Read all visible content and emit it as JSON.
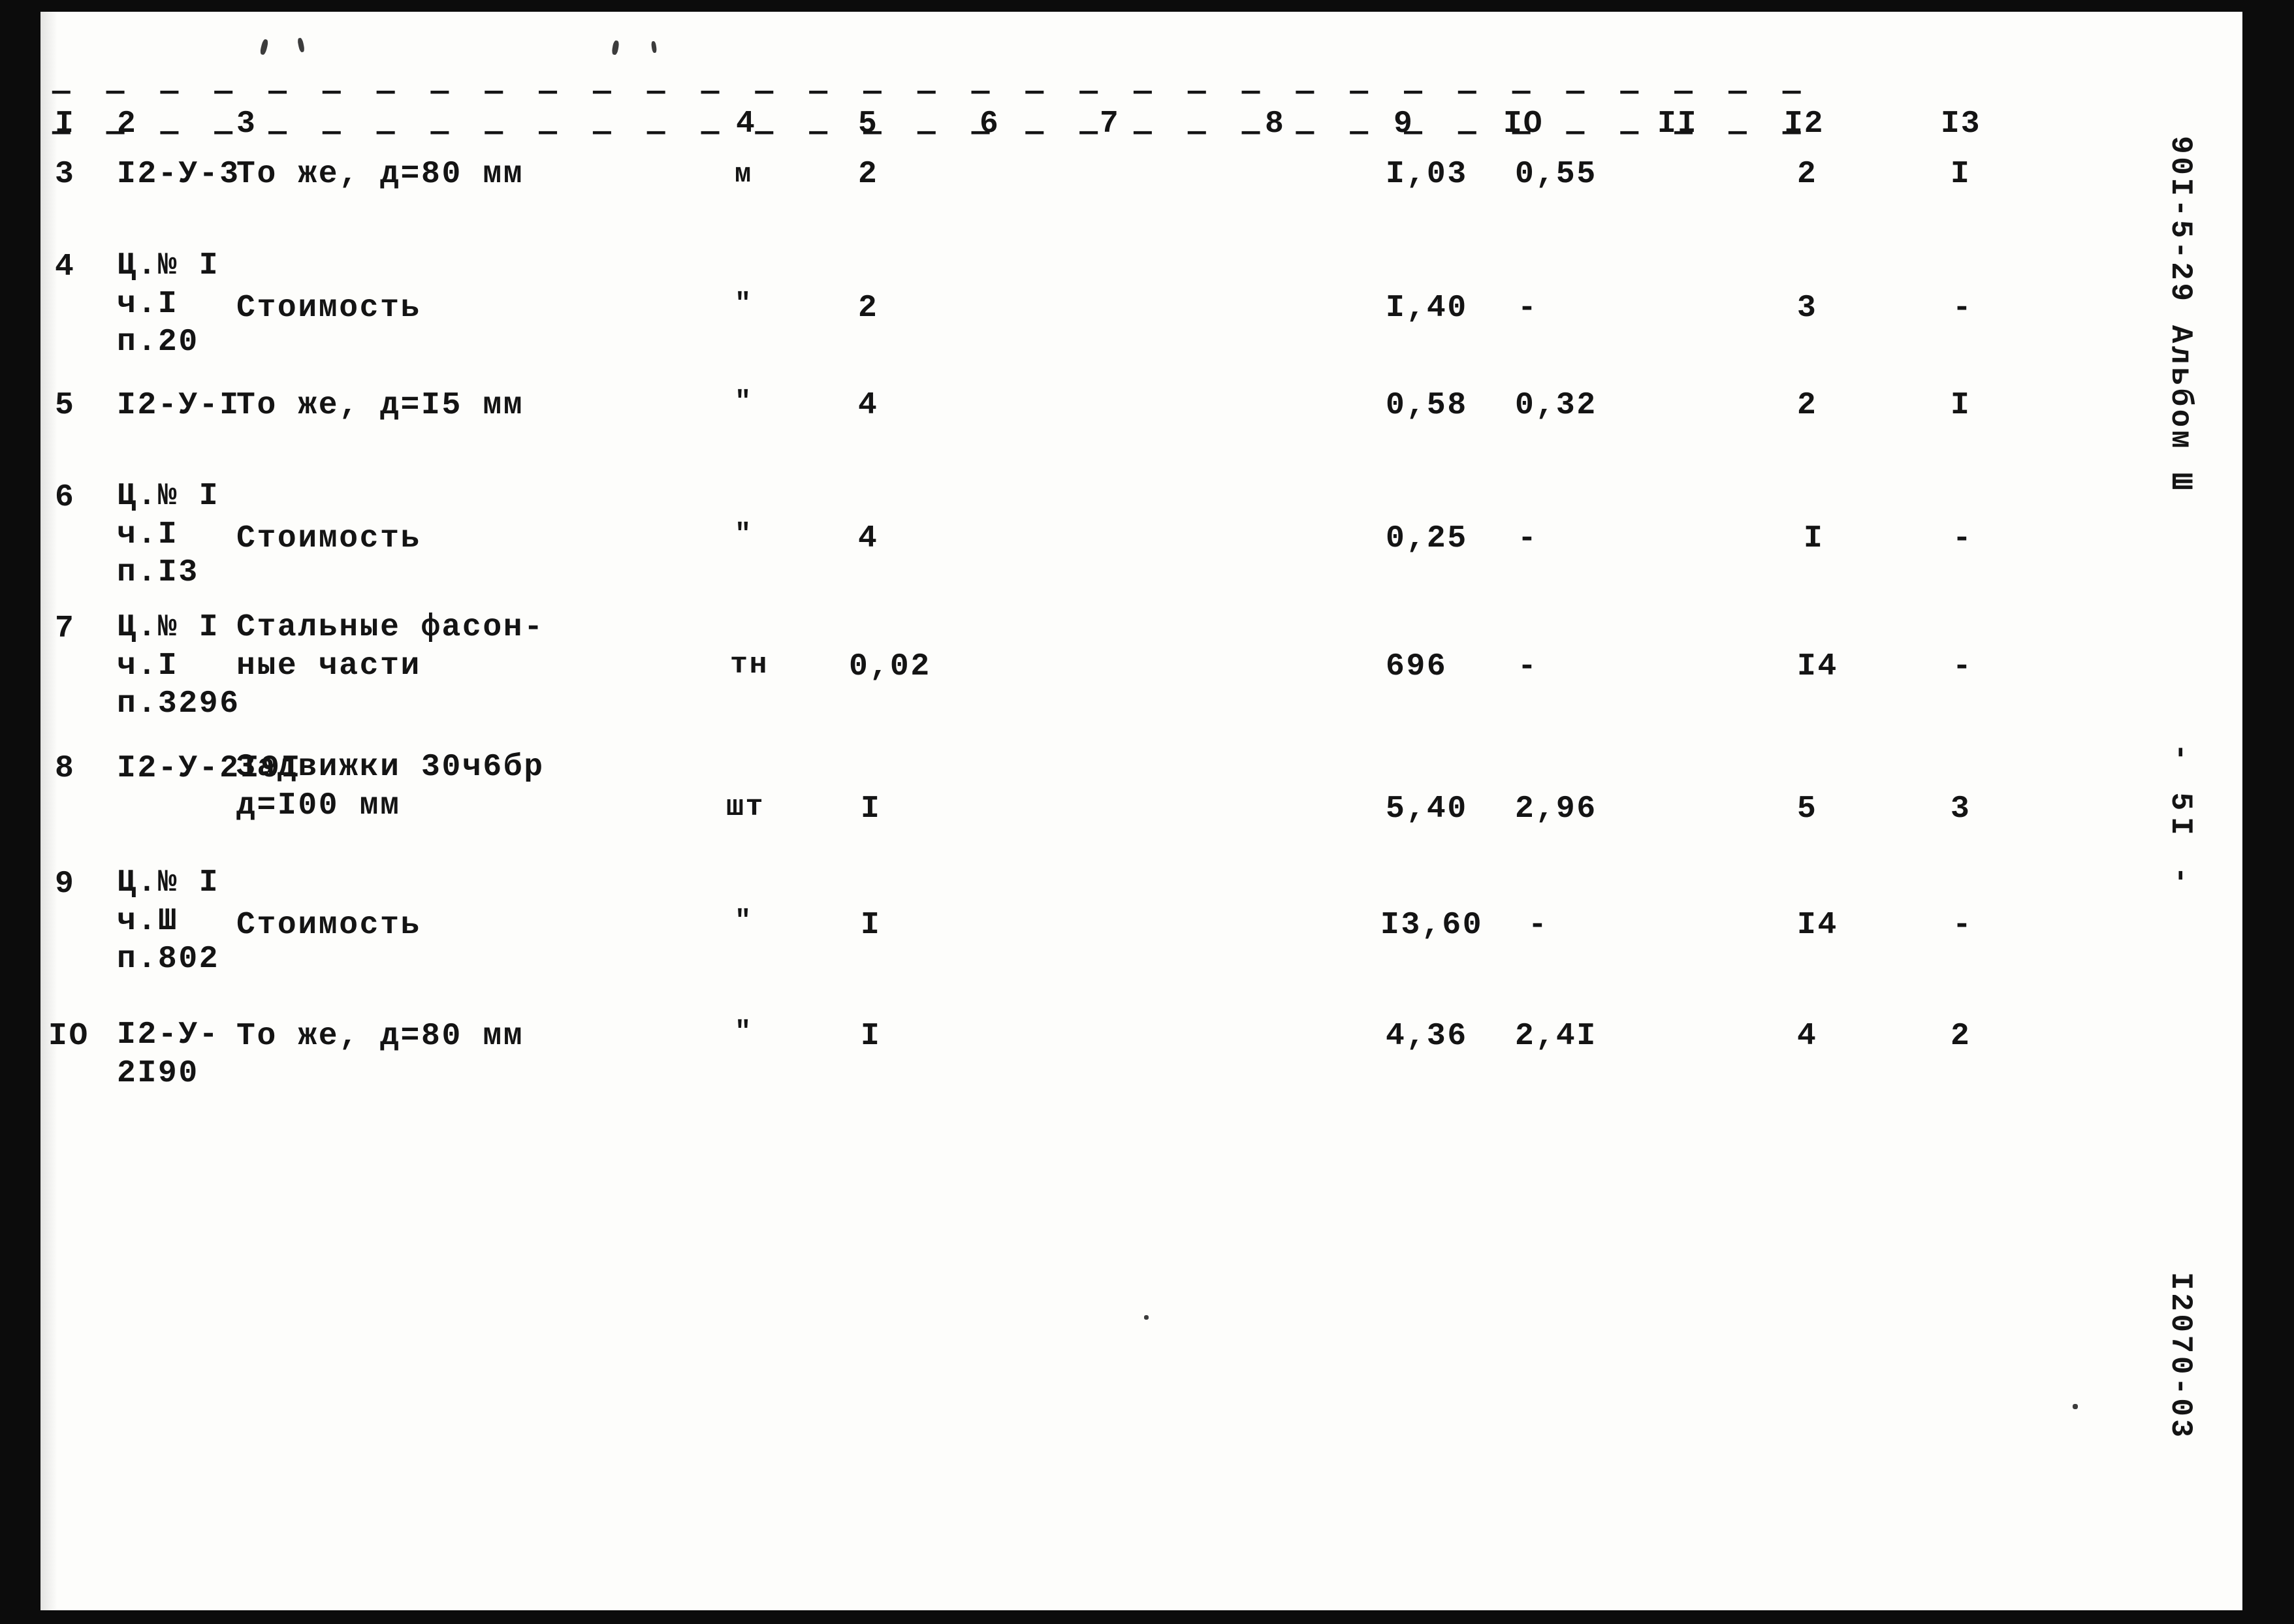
{
  "document": {
    "type": "scanned-typewritten-table",
    "language": "ru",
    "paper_color": "#fdfdfb",
    "ink_color": "#141414"
  },
  "margin_notes": {
    "album_ref": "90I-5-29 Альбом Ш",
    "page_number": "- 5I -",
    "drawing_code": "I2070-03"
  },
  "table": {
    "column_headers": [
      "I",
      "2",
      "3",
      "4",
      "5",
      "6",
      "7",
      "8",
      "9",
      "IO",
      "II",
      "I2",
      "I3"
    ],
    "rows": [
      {
        "c1": "3",
        "c2": "I2-У-3",
        "c3": "То же, д=80 мм",
        "c4": "м",
        "c5": "2",
        "c6": "",
        "c7": "",
        "c8": "",
        "c9": "I,03",
        "c10": "0,55",
        "c11": "",
        "c12": "2",
        "c13": "I"
      },
      {
        "c1": "4",
        "c2": "Ц.№ I\nч.I\nп.20",
        "c3": "Стоимость",
        "c4": "\"",
        "c5": "2",
        "c6": "",
        "c7": "",
        "c8": "",
        "c9": "I,40",
        "c10": "-",
        "c11": "",
        "c12": "3",
        "c13": "-"
      },
      {
        "c1": "5",
        "c2": "I2-У-I",
        "c3": "То же, д=I5 мм",
        "c4": "\"",
        "c5": "4",
        "c6": "",
        "c7": "",
        "c8": "",
        "c9": "0,58",
        "c10": "0,32",
        "c11": "",
        "c12": "2",
        "c13": "I"
      },
      {
        "c1": "6",
        "c2": "Ц.№ I\nч.I\nп.I3",
        "c3": "Стоимость",
        "c4": "\"",
        "c5": "4",
        "c6": "",
        "c7": "",
        "c8": "",
        "c9": "0,25",
        "c10": "-",
        "c11": "",
        "c12": "I",
        "c13": "-"
      },
      {
        "c1": "7",
        "c2": "Ц.№ I\nч.I\nп.3296",
        "c3": "Стальные фасон-\nные части",
        "c4": "тн",
        "c5": "0,02",
        "c6": "",
        "c7": "",
        "c8": "",
        "c9": "696",
        "c10": "-",
        "c11": "",
        "c12": "I4",
        "c13": "-"
      },
      {
        "c1": "8",
        "c2": "I2-У-2I9I",
        "c3": "Задвижки 30ч6бр\nд=I00 мм",
        "c4": "шт",
        "c5": "I",
        "c6": "",
        "c7": "",
        "c8": "",
        "c9": "5,40",
        "c10": "2,96",
        "c11": "",
        "c12": "5",
        "c13": "3"
      },
      {
        "c1": "9",
        "c2": "Ц.№ I\nч.Ш\nп.802",
        "c3": "Стоимость",
        "c4": "\"",
        "c5": "I",
        "c6": "",
        "c7": "",
        "c8": "",
        "c9": "I3,60",
        "c10": "-",
        "c11": "",
        "c12": "I4",
        "c13": "-"
      },
      {
        "c1": "IO",
        "c2": "I2-У-\n2I90",
        "c3": "То же, д=80 мм",
        "c4": "\"",
        "c5": "I",
        "c6": "",
        "c7": "",
        "c8": "",
        "c9": "4,36",
        "c10": "2,4I",
        "c11": "",
        "c12": "4",
        "c13": "2"
      }
    ]
  },
  "rules": {
    "top_rule": "— — — — — — — — — — — — — — — — — — — — — — — — — — — — — — — — —",
    "header_rule": "— — — — — — — — — — — — — — — — — — — — — — — — — — — — — — — — —"
  }
}
